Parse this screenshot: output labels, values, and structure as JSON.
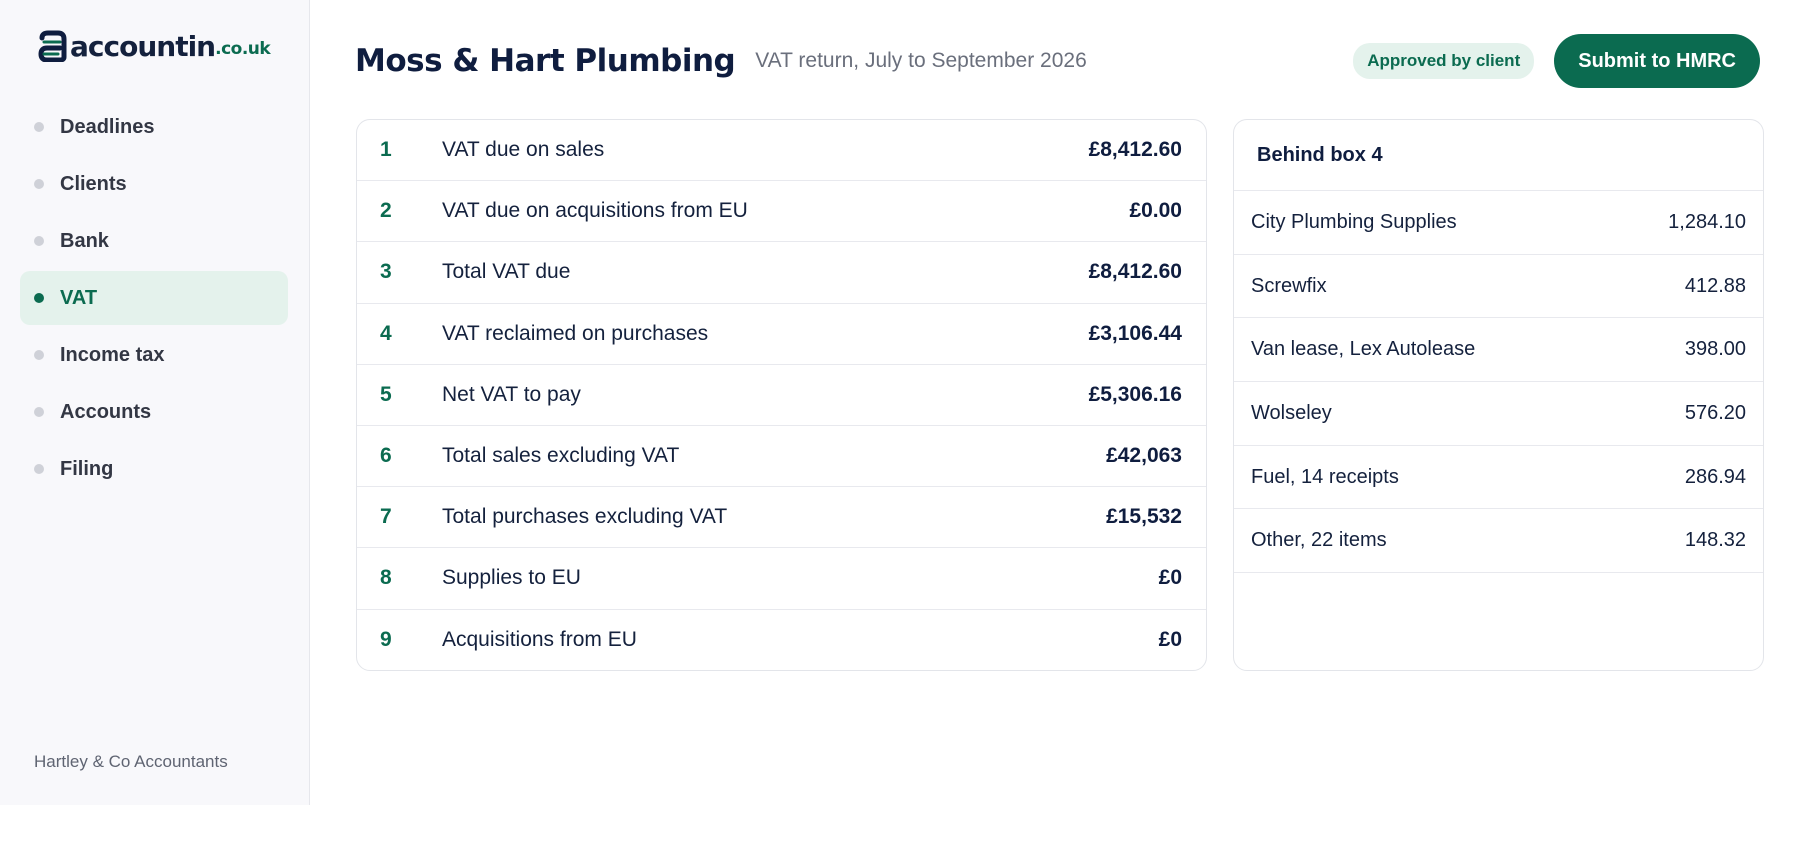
{
  "brand": {
    "name": "accountin",
    "tld": ".co.uk",
    "accent": "#0b6b50",
    "navy": "#0f1d3f"
  },
  "sidebar": {
    "items": [
      {
        "label": "Deadlines",
        "active": false
      },
      {
        "label": "Clients",
        "active": false
      },
      {
        "label": "Bank",
        "active": false
      },
      {
        "label": "VAT",
        "active": true
      },
      {
        "label": "Income tax",
        "active": false
      },
      {
        "label": "Accounts",
        "active": false
      },
      {
        "label": "Filing",
        "active": false
      }
    ],
    "firm": "Hartley & Co Accountants"
  },
  "header": {
    "client": "Moss & Hart Plumbing",
    "period": "VAT return, July to September 2026",
    "status_badge": "Approved by client",
    "submit_label": "Submit to HMRC"
  },
  "vat_boxes": [
    {
      "num": "1",
      "label": "VAT due on sales",
      "value": "£8,412.60"
    },
    {
      "num": "2",
      "label": "VAT due on acquisitions from EU",
      "value": "£0.00"
    },
    {
      "num": "3",
      "label": "Total VAT due",
      "value": "£8,412.60"
    },
    {
      "num": "4",
      "label": "VAT reclaimed on purchases",
      "value": "£3,106.44"
    },
    {
      "num": "5",
      "label": "Net VAT to pay",
      "value": "£5,306.16"
    },
    {
      "num": "6",
      "label": "Total sales excluding VAT",
      "value": "£42,063"
    },
    {
      "num": "7",
      "label": "Total purchases excluding VAT",
      "value": "£15,532"
    },
    {
      "num": "8",
      "label": "Supplies to EU",
      "value": "£0"
    },
    {
      "num": "9",
      "label": "Acquisitions from EU",
      "value": "£0"
    }
  ],
  "breakdown": {
    "title": "Behind box 4",
    "items": [
      {
        "label": "City Plumbing Supplies",
        "amount": "1,284.10"
      },
      {
        "label": "Screwfix",
        "amount": "412.88"
      },
      {
        "label": "Van lease, Lex Autolease",
        "amount": "398.00"
      },
      {
        "label": "Wolseley",
        "amount": "576.20"
      },
      {
        "label": "Fuel, 14 receipts",
        "amount": "286.94"
      },
      {
        "label": "Other, 22 items",
        "amount": "148.32"
      }
    ]
  }
}
